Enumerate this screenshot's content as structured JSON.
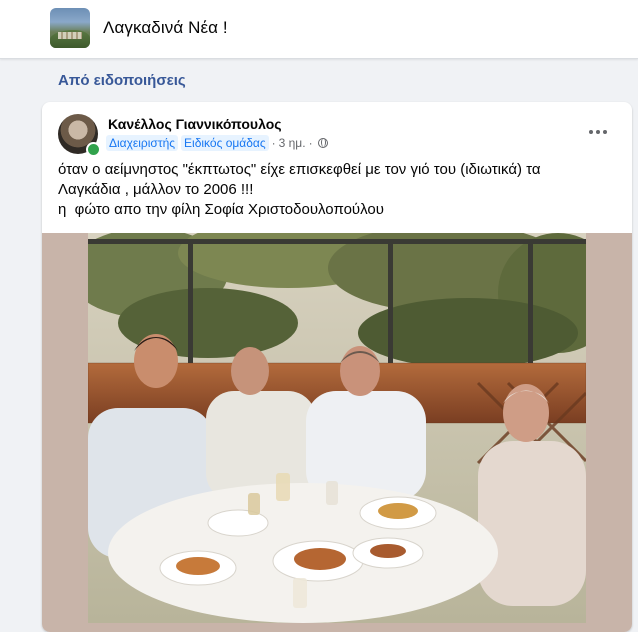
{
  "group": {
    "name": "Λαγκαδινά Νέα !"
  },
  "feed": {
    "source_label": "Από ειδοποιήσεις"
  },
  "post": {
    "author": "Κανέλλος Γιαννικόπουλος",
    "badges": [
      "Διαχειριστής",
      "Ειδικός ομάδας"
    ],
    "time": "3 ημ.",
    "separator": "·",
    "privacy_icon": "globe-icon",
    "text_lines": [
      "όταν ο αείμνηστος \"έκπτωτος\" είχε επισκεφθεί με τον γιό του (ιδιωτικά) τα",
      "Λαγκάδια , μάλλον το 2006 !!!",
      "η  φώτο απο την φίλη Σοφία Χριστοδουλοπούλου"
    ]
  },
  "colors": {
    "link_blue": "#385898",
    "badge_bg": "#e7f3ff",
    "badge_text": "#1877f2",
    "online_green": "#31a24c",
    "page_bg": "#f0f2f5"
  }
}
